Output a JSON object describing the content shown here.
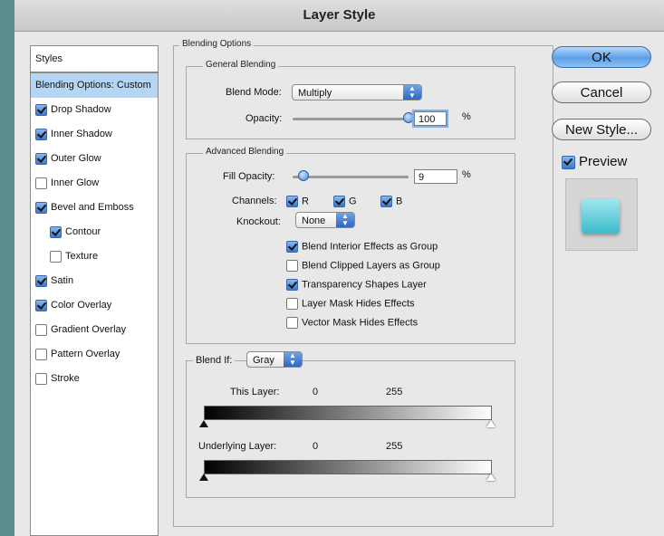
{
  "window": {
    "title": "Layer Style"
  },
  "styles": {
    "header": "Styles",
    "items": [
      {
        "label": "Blending Options: Custom",
        "checkbox": false,
        "checked": false,
        "selected": true
      },
      {
        "label": "Drop Shadow",
        "checkbox": true,
        "checked": true
      },
      {
        "label": "Inner Shadow",
        "checkbox": true,
        "checked": true
      },
      {
        "label": "Outer Glow",
        "checkbox": true,
        "checked": true
      },
      {
        "label": "Inner Glow",
        "checkbox": true,
        "checked": false
      },
      {
        "label": "Bevel and Emboss",
        "checkbox": true,
        "checked": true
      },
      {
        "label": "Contour",
        "checkbox": true,
        "checked": true,
        "indent": true
      },
      {
        "label": "Texture",
        "checkbox": true,
        "checked": false,
        "indent": true
      },
      {
        "label": "Satin",
        "checkbox": true,
        "checked": true
      },
      {
        "label": "Color Overlay",
        "checkbox": true,
        "checked": true
      },
      {
        "label": "Gradient Overlay",
        "checkbox": true,
        "checked": false
      },
      {
        "label": "Pattern Overlay",
        "checkbox": true,
        "checked": false
      },
      {
        "label": "Stroke",
        "checkbox": true,
        "checked": false
      }
    ]
  },
  "blending": {
    "section_title": "Blending Options",
    "general": {
      "title": "General Blending",
      "blend_mode_label": "Blend Mode:",
      "blend_mode_value": "Multiply",
      "opacity_label": "Opacity:",
      "opacity_value": "100",
      "opacity_level": 1.0,
      "percent": "%"
    },
    "advanced": {
      "title": "Advanced Blending",
      "fill_opacity_label": "Fill Opacity:",
      "fill_opacity_value": "9",
      "fill_opacity_level": 0.09,
      "percent": "%",
      "channels_label": "Channels:",
      "channel_r": "R",
      "channel_g": "G",
      "channel_b": "B",
      "knockout_label": "Knockout:",
      "knockout_value": "None",
      "options": [
        {
          "label": "Blend Interior Effects as Group",
          "checked": true
        },
        {
          "label": "Blend Clipped Layers as Group",
          "checked": false
        },
        {
          "label": "Transparency Shapes Layer",
          "checked": true
        },
        {
          "label": "Layer Mask Hides Effects",
          "checked": false
        },
        {
          "label": "Vector Mask Hides Effects",
          "checked": false
        }
      ]
    },
    "blend_if": {
      "label": "Blend If:",
      "value": "Gray",
      "this_layer_label": "This Layer:",
      "this_layer_min": "0",
      "this_layer_max": "255",
      "underlying_label": "Underlying Layer:",
      "underlying_min": "0",
      "underlying_max": "255"
    }
  },
  "buttons": {
    "ok": "OK",
    "cancel": "Cancel",
    "new_style": "New Style...",
    "preview_label": "Preview"
  },
  "colors": {
    "accent": "#5b9fe8",
    "selection": "#b5d5f5",
    "preview_swatch": "#5fcad6"
  }
}
